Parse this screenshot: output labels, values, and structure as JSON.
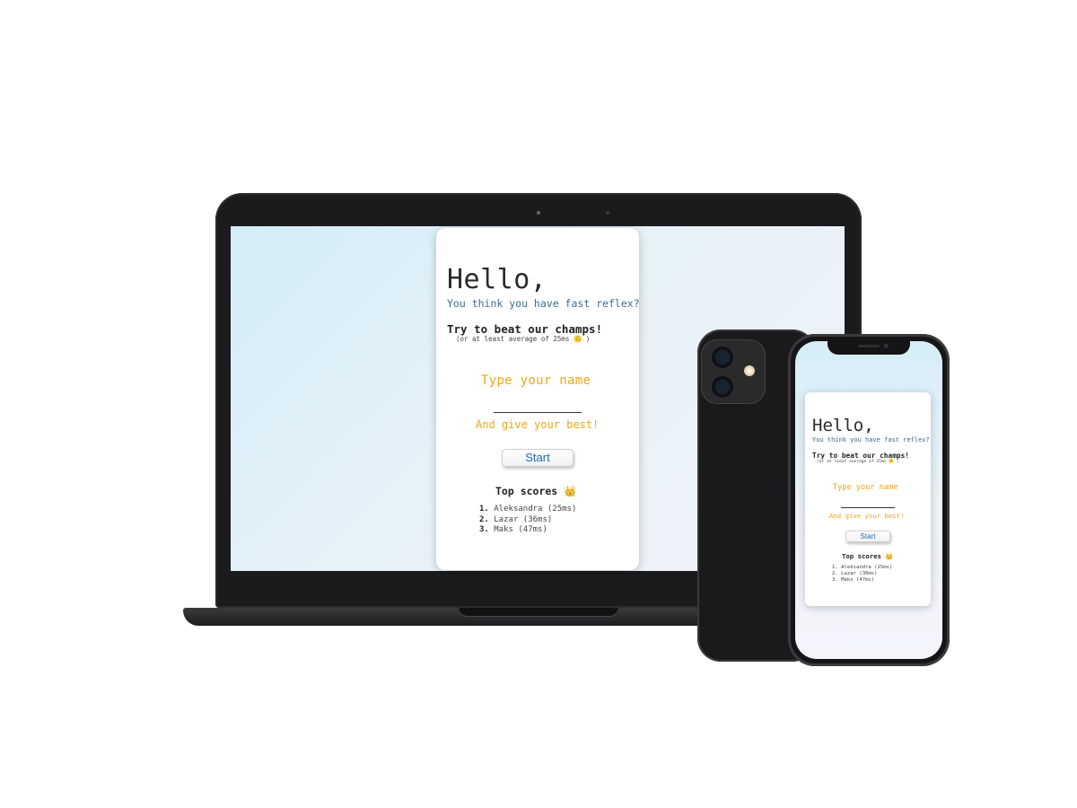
{
  "app": {
    "greeting": "Hello,",
    "subtitle": "You think you have fast reflex?",
    "challenge": "Try to beat our champs!",
    "average_note": "(or at least average of 25ms 🙃 )",
    "name_prompt": "Type your name",
    "encouragement": "And give your best!",
    "start_label": "Start",
    "top_scores_title": "Top scores",
    "crown_icon": "👑",
    "scores": [
      {
        "rank": "1.",
        "entry": "Aleksandra (25ms)"
      },
      {
        "rank": "2.",
        "entry": "Lazar (36ms)"
      },
      {
        "rank": "3.",
        "entry": "Maks (47ms)"
      }
    ]
  },
  "colors": {
    "accent_orange": "#f2a615",
    "subtitle_blue": "#3a6c90",
    "button_text_blue": "#1e6bb8"
  },
  "icons": {
    "apple": ""
  }
}
